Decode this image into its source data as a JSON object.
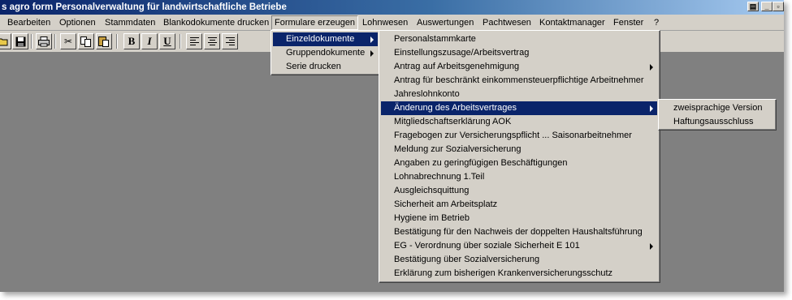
{
  "window": {
    "title": "s agro form Personalverwaltung für landwirtschaftliche Betriebe",
    "controls": [
      "print-icon",
      "minimize-icon",
      "restore-icon"
    ]
  },
  "menubar": {
    "items": [
      {
        "label": "Bearbeiten"
      },
      {
        "label": "Optionen"
      },
      {
        "label": "Stammdaten"
      },
      {
        "label": "Blankodokumente drucken"
      },
      {
        "label": "Formulare erzeugen"
      },
      {
        "label": "Lohnwesen"
      },
      {
        "label": "Auswertungen"
      },
      {
        "label": "Pachtwesen"
      },
      {
        "label": "Kontaktmanager"
      },
      {
        "label": "Fenster"
      },
      {
        "label": "?"
      }
    ],
    "active": "Formulare erzeugen"
  },
  "toolbar": {
    "buttons": [
      {
        "icon": "open-folder-icon"
      },
      {
        "icon": "save-icon"
      },
      {
        "icon": "print-icon"
      },
      {
        "icon": "cut-icon"
      },
      {
        "icon": "copy-icon"
      },
      {
        "icon": "paste-icon"
      },
      {
        "icon": "bold-icon",
        "label": "B"
      },
      {
        "icon": "italic-icon",
        "label": "I"
      },
      {
        "icon": "underline-icon",
        "label": "U"
      },
      {
        "icon": "align-left-icon"
      },
      {
        "icon": "align-center-icon"
      },
      {
        "icon": "align-right-icon"
      }
    ]
  },
  "formulare_menu": {
    "items": [
      {
        "label": "Einzeldokumente"
      },
      {
        "label": "Gruppendokumente"
      },
      {
        "label": "Serie drucken"
      }
    ],
    "highlighted": "Einzeldokumente"
  },
  "einzeldokumente_menu": {
    "items": [
      {
        "label": "Personalstammkarte"
      },
      {
        "label": "Einstellungszusage/Arbeitsvertrag"
      },
      {
        "label": "Antrag auf Arbeitsgenehmigung"
      },
      {
        "label": "Antrag für beschränkt einkommensteuerpflichtige Arbeitnehmer"
      },
      {
        "label": "Jahreslohnkonto"
      },
      {
        "label": "Änderung des Arbeitsvertrages"
      },
      {
        "label": "Mitgliedschaftserklärung AOK"
      },
      {
        "label": "Fragebogen zur Versicherungspflicht ... Saisonarbeitnehmer"
      },
      {
        "label": "Meldung zur Sozialversicherung"
      },
      {
        "label": "Angaben zu geringfügigen Beschäftigungen"
      },
      {
        "label": "Lohnabrechnung 1.Teil"
      },
      {
        "label": "Ausgleichsquittung"
      },
      {
        "label": "Sicherheit am Arbeitsplatz"
      },
      {
        "label": "Hygiene im Betrieb"
      },
      {
        "label": "Bestätigung für den Nachweis der doppelten Haushaltsführung"
      },
      {
        "label": "EG - Verordnung über soziale Sicherheit E 101"
      },
      {
        "label": "Bestätigung über Sozialversicherung"
      },
      {
        "label": "Erklärung zum bisherigen Krankenversicherungsschutz"
      }
    ],
    "highlighted": "Änderung des Arbeitsvertrages"
  },
  "aenderung_menu": {
    "items": [
      {
        "label": "zweisprachige Version"
      },
      {
        "label": "Haftungsausschluss"
      }
    ]
  },
  "colors": {
    "titlebar": "#0a246a",
    "menu_face": "#d4d0c8",
    "highlight": "#0a246a",
    "workspace": "#808080"
  }
}
